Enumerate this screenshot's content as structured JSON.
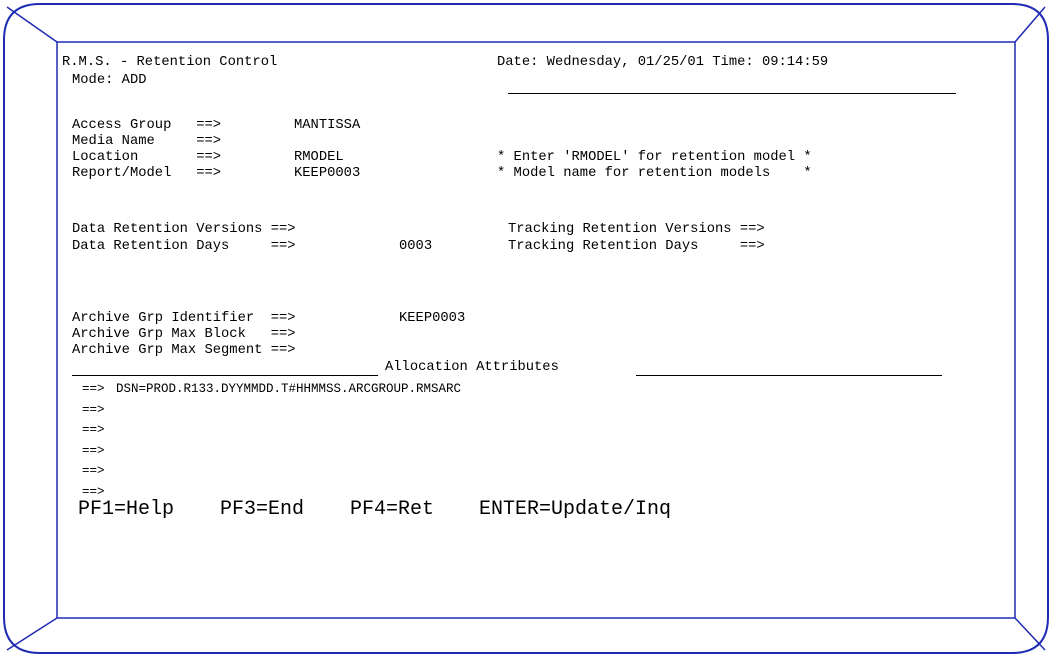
{
  "header": {
    "title": "R.M.S. - Retention Control",
    "datetime": "Date: Wednesday, 01/25/01 Time: 09:14:59",
    "mode": "Mode: ADD"
  },
  "fields": {
    "access_group_label": "Access Group   ==>",
    "access_group_value": "MANTISSA",
    "media_name_label": "Media Name     ==>",
    "media_name_value": "",
    "location_label": "Location       ==>",
    "location_value": "RMODEL",
    "location_note": "* Enter 'RMODEL' for retention model *",
    "report_label": "Report/Model   ==>",
    "report_value": "KEEP0003",
    "report_note": "* Model name for retention models    *",
    "data_ret_versions_label": "Data Retention Versions ==>",
    "data_ret_versions_value": "",
    "tracking_ret_versions_label": "Tracking Retention Versions ==>",
    "tracking_ret_versions_value": "",
    "data_ret_days_label": "Data Retention Days     ==>",
    "data_ret_days_value": "0003",
    "tracking_ret_days_label": "Tracking Retention Days     ==>",
    "tracking_ret_days_value": "",
    "archive_id_label": "Archive Grp Identifier  ==>",
    "archive_id_value": "KEEP0003",
    "archive_block_label": "Archive Grp Max Block   ==>",
    "archive_block_value": "",
    "archive_segment_label": "Archive Grp Max Segment ==>",
    "archive_segment_value": ""
  },
  "allocation": {
    "title": "Allocation Attributes",
    "prompt": "==>",
    "lines": [
      "DSN=PROD.R133.DYYMMDD.T#HHMMSS.ARCGROUP.RMSARC",
      "",
      "",
      "",
      "",
      ""
    ]
  },
  "function_keys": {
    "pf1": "PF1=Help",
    "pf3": "PF3=End",
    "pf4": "PF4=Ret",
    "enter": "ENTER=Update/Inq"
  },
  "colors": {
    "frame": "#1f2bb3",
    "text": "#000000",
    "background": "#ffffff"
  }
}
